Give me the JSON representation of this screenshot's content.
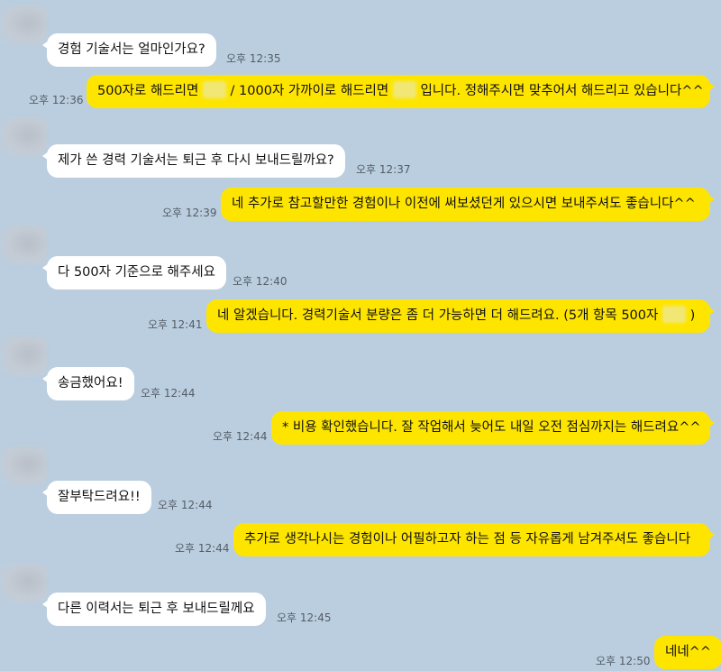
{
  "messages": [
    {
      "dir": "in",
      "text": "경험 기술서는 얼마인가요?",
      "time": "오후 12:35"
    },
    {
      "dir": "out",
      "parts": [
        "500자로 해드리면",
        "/ 1000자 가까이로 해드리면",
        "입니다. 정해주시면 맞추어서 해드리고 있습니다^^"
      ],
      "time": "오후 12:36"
    },
    {
      "dir": "in",
      "text": "제가 쓴 경력 기술서는 퇴근 후 다시 보내드릴까요?",
      "time": "오후 12:37"
    },
    {
      "dir": "out",
      "text": "네 추가로 참고할만한 경험이나 이전에 써보셨던게 있으시면 보내주셔도 좋습니다^^",
      "time": "오후 12:39"
    },
    {
      "dir": "in",
      "text": "다 500자 기준으로 해주세요",
      "time": "오후 12:40"
    },
    {
      "dir": "out",
      "parts": [
        "네 알겠습니다. 경력기술서 분량은 좀 더 가능하면 더 해드려요. (5개 항목 500자",
        ")"
      ],
      "time": "오후 12:41"
    },
    {
      "dir": "in",
      "text": "송금했어요!",
      "time": "오후 12:44"
    },
    {
      "dir": "out",
      "text": "* 비용 확인했습니다. 잘 작업해서 늦어도 내일 오전 점심까지는 해드려요^^",
      "time": "오후 12:44"
    },
    {
      "dir": "in",
      "text": "잘부탁드려요!!",
      "time": "오후 12:44"
    },
    {
      "dir": "out",
      "text": "추가로 생각나시는 경험이나 어필하고자 하는 점 등 자유롭게 남겨주셔도 좋습니다",
      "time": "오후 12:44"
    },
    {
      "dir": "in",
      "text": "다른 이력서는 퇴근 후 보내드릴께요",
      "time": "오후 12:45"
    },
    {
      "dir": "out",
      "text": "네네^^",
      "time": "오후 12:50"
    }
  ],
  "colors": {
    "background": "#bacee0",
    "incoming": "#ffffff",
    "outgoing": "#fee500"
  }
}
